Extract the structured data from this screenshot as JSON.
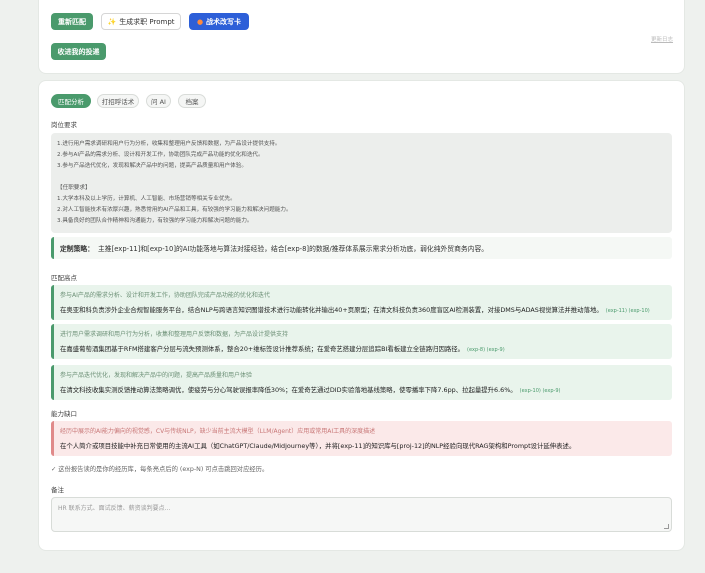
{
  "top": {
    "rematch_label": "重新匹配",
    "prompt_label": "生成求职 Prompt",
    "prompt_icon": "sparkle-icon",
    "rewrite_label": "战术改写卡",
    "rewrite_icon": "fire-icon",
    "favorites_label": "收进我的投递",
    "right_link": "更新日志"
  },
  "tabs": [
    {
      "label": "匹配分析"
    },
    {
      "label": "打招呼话术"
    },
    {
      "label": "问 AI"
    },
    {
      "label": "档案"
    }
  ],
  "jd": {
    "section_label": "岗位要求",
    "lines": [
      "1.进行用户需求调研和用户行为分析，收集和整理用户反馈和数据，为产品设计提供支持。",
      "2.参与AI产品的需求分析、设计和开发工作，协助团队完成产品功能的优化和迭代。",
      "3.参与产品迭代优化，发现和解决产品中的问题，提高产品质量和用户体验。",
      "",
      "【任职要求】",
      "1.大学本科及以上学历，计算机、人工智能、市场营销等相关专业优先。",
      "2.对人工智能技术有浓厚兴趣，熟悉常用的AI产品和工具，有较强的学习能力和解决问题能力。",
      "3.具备良好的团队合作精神和沟通能力，有较强的学习能力和解决问题的能力。"
    ]
  },
  "strategy": {
    "label": "定制策略：",
    "text": "主推[exp-11]和[exp-10]的AI功能落地与算法对接经验，结合[exp-8]的数据/推荐体系展示需求分析功底，弱化纯外贸商务内容。"
  },
  "highlights": {
    "section_label": "匹配高点",
    "items": [
      {
        "q": "参与AI产品的需求分析、设计和开发工作，协助团队完成产品功能的优化和迭代",
        "a": "在奥亚和科负责涉外企业合规智能服务平台，结合NLP与跨语言知识图谱技术进行功能转化并输出40+页原型；在清文科技负责360度盲区AI检测装置，对接DMS与ADAS视觉算法并推动落地。",
        "tags": "(exp-11) (exp-10)"
      },
      {
        "q": "进行用户需求调研和用户行为分析，收集和整理用户反馈和数据，为产品设计提供支持",
        "a": "在嘉盛葡萄酒集团基于RFM搭建客户分层与流失预测体系，整合20+维标签设计推荐系统；在爱奇艺搭建分层追踪BI看板建立全链路归因路径。",
        "tags": "(exp-8) (exp-9)"
      },
      {
        "q": "参与产品迭代优化，发现和解决产品中的问题，提高产品质量和用户体验",
        "a": "在清文科技收集实测反馈推动算法策略调优，使疲劳与分心驾驶误报率降低30%；在爱奇艺通过DID实验落地基线策略，使零播率下降7.6pp、拉起量提升6.6%。",
        "tags": "(exp-10) (exp-9)"
      }
    ]
  },
  "gaps": {
    "section_label": "能力缺口",
    "q": "经历中展示的AI能力偏向的视觉感，CV与传统NLP，缺少当前主流大模型（LLM/Agent）应用或常用AI工具的深度描述",
    "a": "在个人简介或项目技能中补充日常使用的主流AI工具（如ChatGPT/Claude/Midjourney等），并将[exp-11]的知识库与[proj-12]的NLP经验向现代RAG架构和Prompt设计延伸表述。"
  },
  "note": "✓ 这份报告读的是你的经历库，每条亮点后的 (exp-N) 可点击跳回对应经历。",
  "memo": {
    "section_label": "备注",
    "placeholder": "HR 联系方式、面试反馈、薪资谈判要点..."
  }
}
